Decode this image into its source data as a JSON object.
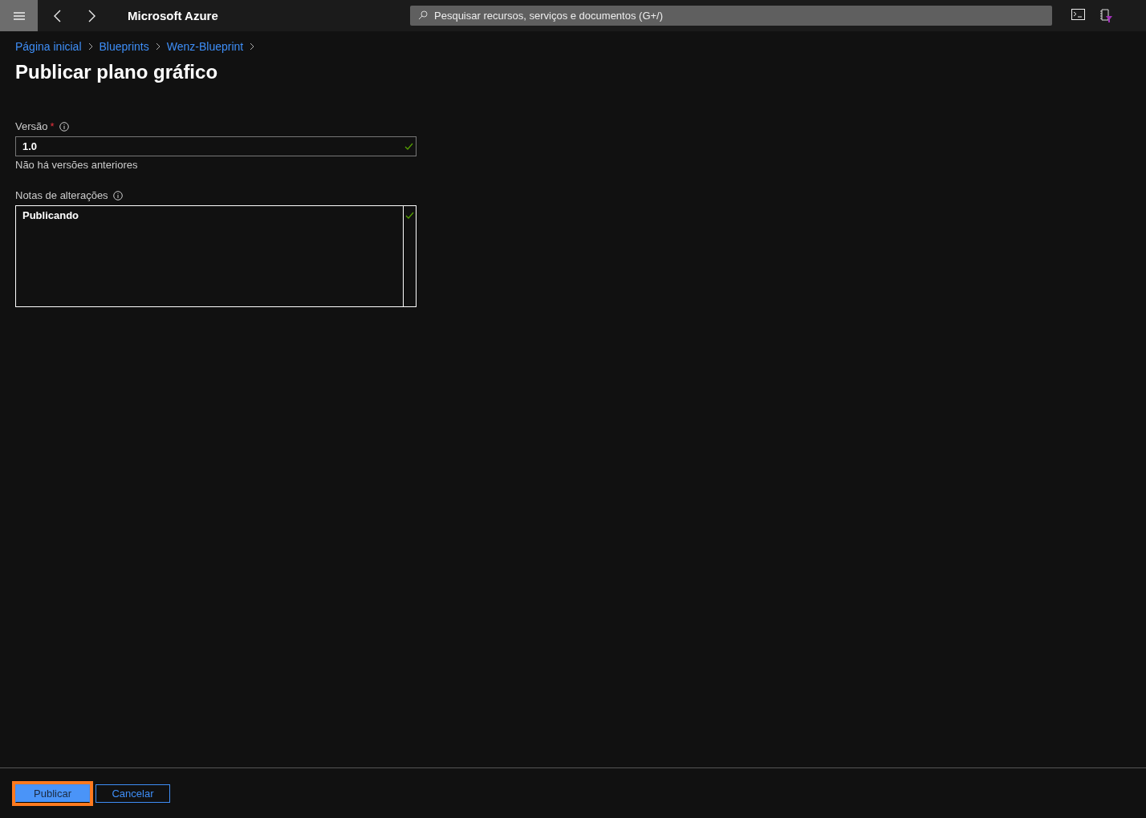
{
  "top_bar": {
    "title": "Microsoft Azure",
    "search": {
      "placeholder": "Pesquisar recursos, serviços e documentos (G+/)"
    }
  },
  "breadcrumb": [
    "Página inicial",
    "Blueprints",
    "Wenz-Blueprint"
  ],
  "page_title": "Publicar plano gráfico",
  "fields": [
    {
      "kind": "input",
      "label": "Versão",
      "required": true,
      "required_mark": "*",
      "value": "1.0",
      "valid": true,
      "hint": "Não há versões anteriores"
    },
    {
      "kind": "textarea",
      "label": "Notas de alterações",
      "required": false,
      "value": "Publicando",
      "valid": true
    }
  ],
  "buttons": [
    {
      "label": "Publicar",
      "kind": "primary",
      "highlighted": true
    },
    {
      "label": "Cancelar",
      "kind": "secondary",
      "highlighted": false
    }
  ]
}
